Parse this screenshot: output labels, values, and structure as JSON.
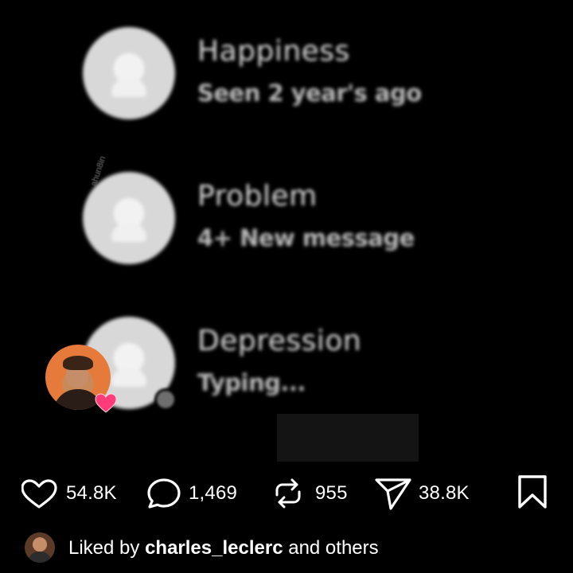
{
  "post": {
    "chats": [
      {
        "name": "Happiness",
        "status": "Seen 2 year's ago"
      },
      {
        "name": "Problem",
        "status": "4+ New message"
      },
      {
        "name": "Depression",
        "status": "Typing..."
      }
    ],
    "watermark": "ahun8in"
  },
  "actions": {
    "likes": "54.8K",
    "comments": "1,469",
    "reposts": "955",
    "shares": "38.8K"
  },
  "liked_by": {
    "prefix": "Liked by",
    "user": "charles_leclerc",
    "suffix": "and others"
  },
  "colors": {
    "background": "#000000",
    "text": "#ffffff",
    "heart_badge": "#ff3b7a"
  },
  "icons": [
    "heart-icon",
    "comment-icon",
    "repost-icon",
    "share-icon",
    "bookmark-icon"
  ]
}
